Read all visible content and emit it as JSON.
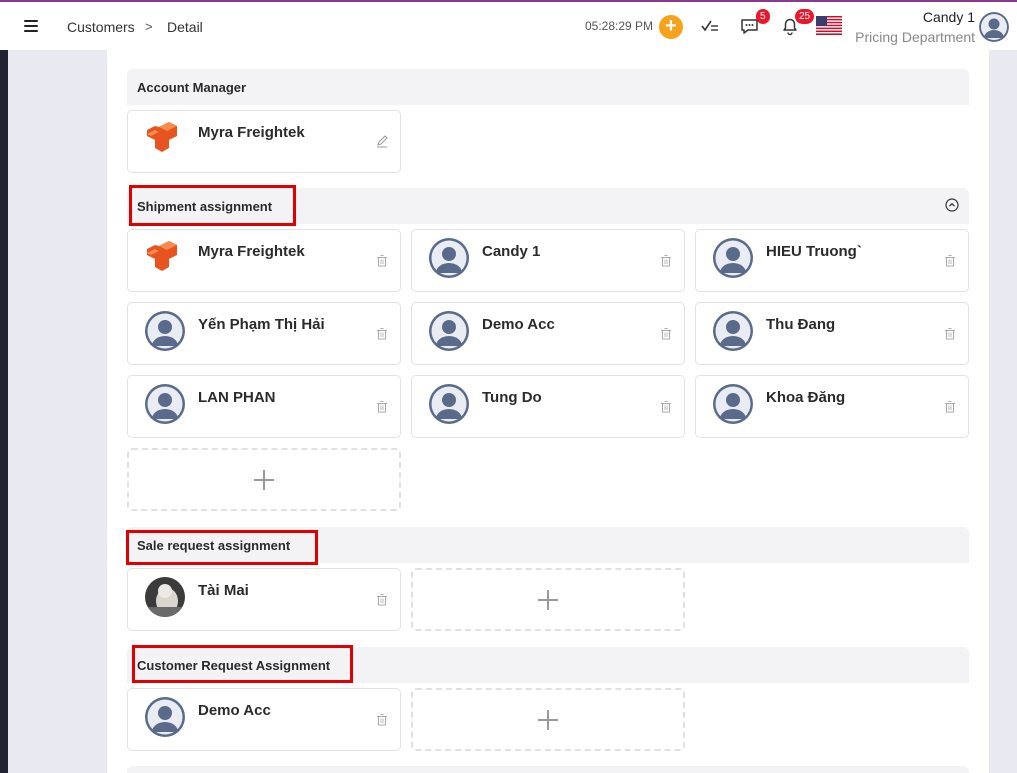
{
  "header": {
    "breadcrumb": [
      "Customers",
      "Detail"
    ],
    "separator": ">",
    "clock": "05:28:29 PM",
    "messages_count": "5",
    "notifications_count": "25",
    "user_name": "Candy 1",
    "user_department": "Pricing Department"
  },
  "account_manager": {
    "title": "Account Manager",
    "name": "Myra Freightek"
  },
  "shipment_assignment": {
    "title": "Shipment assignment",
    "members": [
      "Myra Freightek",
      "Candy 1",
      "HIEU Truong`",
      "Yến Phạm Thị Hải",
      "Demo Acc",
      "Thu Đang",
      "LAN PHAN",
      "Tung Do",
      "Khoa Đăng"
    ]
  },
  "sale_request_assignment": {
    "title": "Sale request assignment",
    "members": [
      "Tài Mai"
    ]
  },
  "customer_request_assignment": {
    "title": "Customer Request Assignment",
    "members": [
      "Demo Acc"
    ]
  },
  "colors": {
    "accent_orange": "#f7a21b",
    "badge_red": "#e8192c",
    "highlight_red": "#e00000",
    "logo_orange": "#e8541f"
  }
}
